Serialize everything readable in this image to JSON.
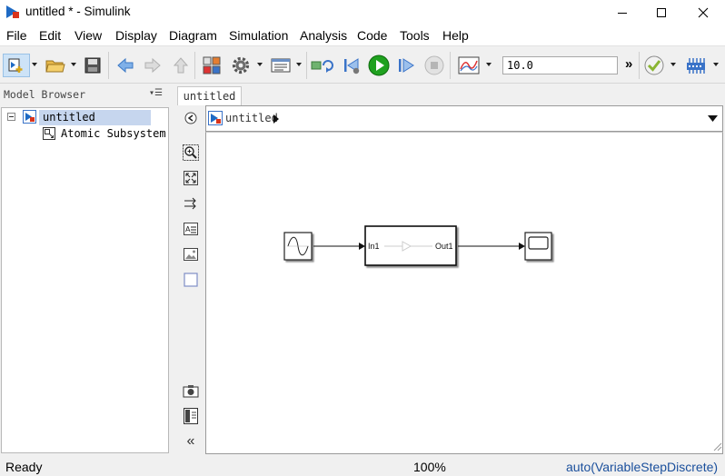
{
  "window": {
    "title": "untitled * - Simulink",
    "app_icon": "simulink-icon",
    "buttons": [
      "minimize-icon",
      "maximize-icon",
      "close-icon"
    ]
  },
  "menu": [
    "File",
    "Edit",
    "View",
    "Display",
    "Diagram",
    "Simulation",
    "Analysis",
    "Code",
    "Tools",
    "Help"
  ],
  "toolbar": {
    "icons": [
      "new-model-icon",
      "open-folder-icon",
      "save-icon",
      "back-arrow-icon",
      "forward-arrow-icon",
      "up-arrow-icon",
      "library-browser-icon",
      "model-settings-gear-icon",
      "model-explorer-icon",
      "update-diagram-icon",
      "step-back-icon",
      "run-icon",
      "step-forward-icon",
      "stop-icon",
      "scope-icon",
      "model-advisor-check-icon",
      "build-icon"
    ],
    "stop_time": "10.0",
    "overflow": "»"
  },
  "model_browser": {
    "header": "Model Browser",
    "tree": [
      {
        "label": "untitled",
        "selected": true
      },
      {
        "label": "Atomic Subsystem",
        "selected": false
      }
    ]
  },
  "editor": {
    "tab": "untitled",
    "breadcrumb": "untitled",
    "palette": [
      "hide-show-browser-icon",
      "zoom-in-icon",
      "fit-to-view-icon",
      "route-lines-icon",
      "annotation-icon",
      "image-icon",
      "area-icon",
      "snapshot-icon",
      "property-inspector-icon",
      "collapse-palette-icon"
    ]
  },
  "diagram": {
    "blocks": [
      {
        "name": "sine-wave-block",
        "type": "Sine Wave"
      },
      {
        "name": "atomic-subsystem-block",
        "type": "Subsystem",
        "in_port": "In1",
        "out_port": "Out1"
      },
      {
        "name": "scope-block",
        "type": "Scope"
      }
    ]
  },
  "status": {
    "left": "Ready",
    "zoom": "100%",
    "solver": "auto(VariableStepDiscrete)"
  },
  "colors": {
    "selection_bg": "#c6d6ee",
    "toolbar_select": "#cde3f7",
    "run_green": "#1fa11f",
    "link_blue": "#1a4f9c"
  }
}
